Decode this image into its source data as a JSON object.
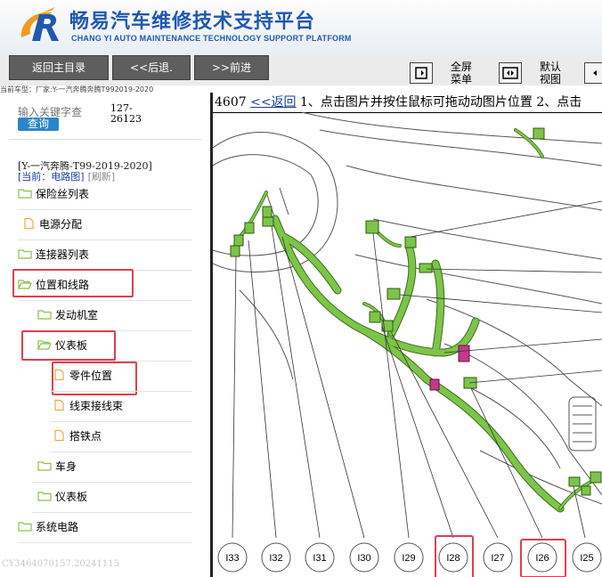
{
  "header": {
    "brand_cn": "畅易汽车维修技术支持平台",
    "brand_en": "CHANG YI AUTO MAINTENANCE TECHNOLOGY SUPPORT PLATFORM"
  },
  "toolbar": {
    "back_main": "返回主目录",
    "back": "<<后退.",
    "forward": ">>前进",
    "fullscreen_l1": "全屏",
    "fullscreen_l2": "菜单",
    "default_l1": "默认",
    "default_l2": "视图"
  },
  "car_info": "当前车型：厂家:Y-一汽奔腾奔腾T992019-2020",
  "sidebar": {
    "search_placeholder": "输入关键字查",
    "search_button": "查询",
    "code_line1": "127-",
    "code_line2": "26123",
    "model_title": "[Y-一汽奔腾-T99-2019-2020]",
    "current_label": "[当前：电路图]",
    "refresh_label": "[刷新]",
    "items": [
      {
        "label": "保险丝列表",
        "icon": "folder-icon"
      },
      {
        "label": "电源分配",
        "icon": "file-icon"
      },
      {
        "label": "连接器列表",
        "icon": "folder-icon"
      },
      {
        "label": "位置和线路",
        "icon": "folder-open-icon"
      },
      {
        "label": "发动机室",
        "icon": "folder-icon"
      },
      {
        "label": "仪表板",
        "icon": "folder-open-icon"
      },
      {
        "label": "零件位置",
        "icon": "file-icon"
      },
      {
        "label": "线束接线束",
        "icon": "file-icon"
      },
      {
        "label": "搭铁点",
        "icon": "file-icon"
      },
      {
        "label": "车身",
        "icon": "folder-icon"
      },
      {
        "label": "仪表板",
        "icon": "folder-icon"
      },
      {
        "label": "系统电路",
        "icon": "folder-icon"
      }
    ]
  },
  "watermark": "CY3464070157.20241115",
  "content": {
    "page_number": "4607",
    "back_link": "<<返回",
    "instruction": "1、点击图片并按住鼠标可拖动动图片位置 2、点击"
  },
  "diagram": {
    "connector_labels": [
      "I33",
      "I32",
      "I31",
      "I30",
      "I29",
      "I28",
      "I27",
      "I26",
      "I25"
    ],
    "highlighted": [
      "I28",
      "I26"
    ]
  },
  "colors": {
    "brand_blue": "#1f58b0",
    "highlight_red": "#e0404e",
    "harness_green": "#7cc548",
    "connector_magenta": "#c23a8a",
    "search_button_blue": "#2a86c8"
  }
}
